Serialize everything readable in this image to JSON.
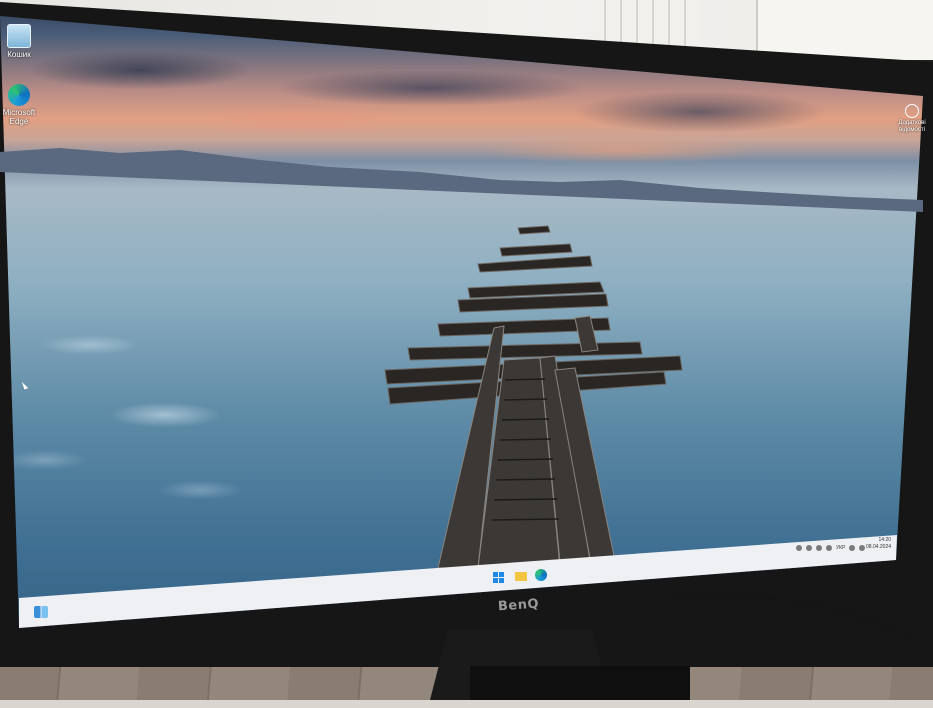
{
  "desktop": {
    "icons": [
      {
        "label": "Кошик",
        "icon": "recycle-bin-icon"
      },
      {
        "label_line1": "Microsoft",
        "label_line2": "Edge",
        "icon": "edge-icon"
      },
      {
        "label_line1": "Додаткові",
        "label_line2": "відомості",
        "icon": "account-info-icon"
      }
    ]
  },
  "taskbar": {
    "items": [
      "widgets-icon",
      "start-icon",
      "file-explorer-icon",
      "edge-icon"
    ],
    "tray_language": "УКР",
    "clock_time": "14:20",
    "clock_date": "08.04.2024"
  },
  "monitor": {
    "brand": "BenQ"
  },
  "colors": {
    "taskbar": "#eef0f4",
    "bezel": "#161616",
    "accent": "#1e88e5"
  }
}
